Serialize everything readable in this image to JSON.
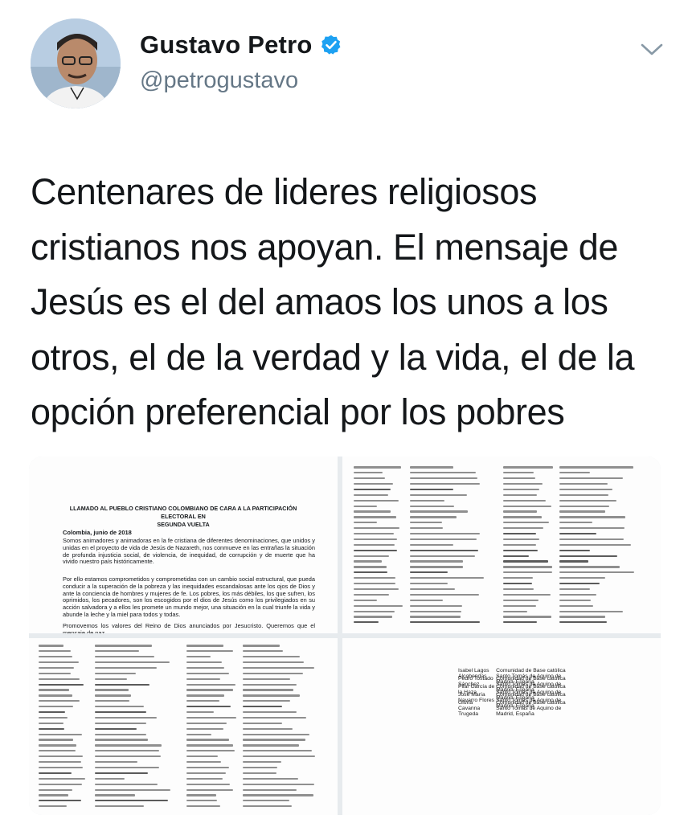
{
  "user": {
    "display_name": "Gustavo Petro",
    "handle": "@petrogustavo",
    "verified": true
  },
  "tweet": {
    "lines": [
      "Centenares de lideres religiosos",
      "cristianos nos apoyan. El mensaje de",
      "Jesús es el del amaos los unos a los",
      "otros, el de la verdad y la vida, el de la",
      "opción preferencial por los pobres"
    ]
  },
  "document": {
    "title_line1": "LLAMADO AL PUEBLO CRISTIANO COLOMBIANO DE CARA A LA PARTICIPACIÓN ELECTORAL EN",
    "title_line2": "SEGUNDA VUELTA",
    "date": "Colombia, junio de 2018",
    "paragraph1": "Somos animadores y animadoras en la fe cristiana de diferentes denominaciones, que unidos y unidas en el proyecto de vida de Jesús de Nazareth, nos conmueve en las entrañas la situación de profunda injusticia social, de violencia, de inequidad, de corrupción y de muerte que ha vivido nuestro país históricamente.",
    "paragraph2": "Por ello estamos comprometidos y comprometidas con un cambio social estructural, que pueda conducir a la superación de la pobreza y las inequidades escandalosas ante los ojos de Dios y ante la conciencia de hombres y mujeres de fe. Los pobres, los más débiles, los que sufren, los oprimidos, los pecadores, son los escogidos por el dios de Jesús como los privilegiados en su acción salvadora y a ellos les promete un mundo mejor, una situación en la cual triunfe la vida y abunde la leche y la miel para todos y todas.",
    "paragraph3": "Promovemos los valores del Reino de Dios anunciados por Jesucristo. Queremos que el mensaje de paz"
  },
  "signatories": [
    {
      "name": "Isabel Lagos Alcobendas",
      "org": "Comunidad de Base católica Santo Tomás de Aquino de Madrid, España"
    },
    {
      "name": "Pedro Tostado Sánchez",
      "org": "Comunidad de Base católica Santo Tomás de Aquino de Madrid, España"
    },
    {
      "name": "Pilar García de la Haza",
      "org": "Comunidad de Base católica Santo Tomás de Aquino de Madrid, España"
    },
    {
      "name": "José María Navarro Flores",
      "org": "Comunidad de Base católica Santo Tomás de Aquino de Madrid, España"
    },
    {
      "name": "Gloria  Cavanna  Trugeda",
      "org": "Comunidad de Base católica Santo Tomás de Aquino de Madrid, España"
    }
  ],
  "colors": {
    "verified_badge": "#1da1f2",
    "secondary_text": "#657786",
    "primary_text": "#14171a"
  },
  "icons": {
    "verified": "verified-badge-icon",
    "menu": "chevron-down-icon"
  }
}
